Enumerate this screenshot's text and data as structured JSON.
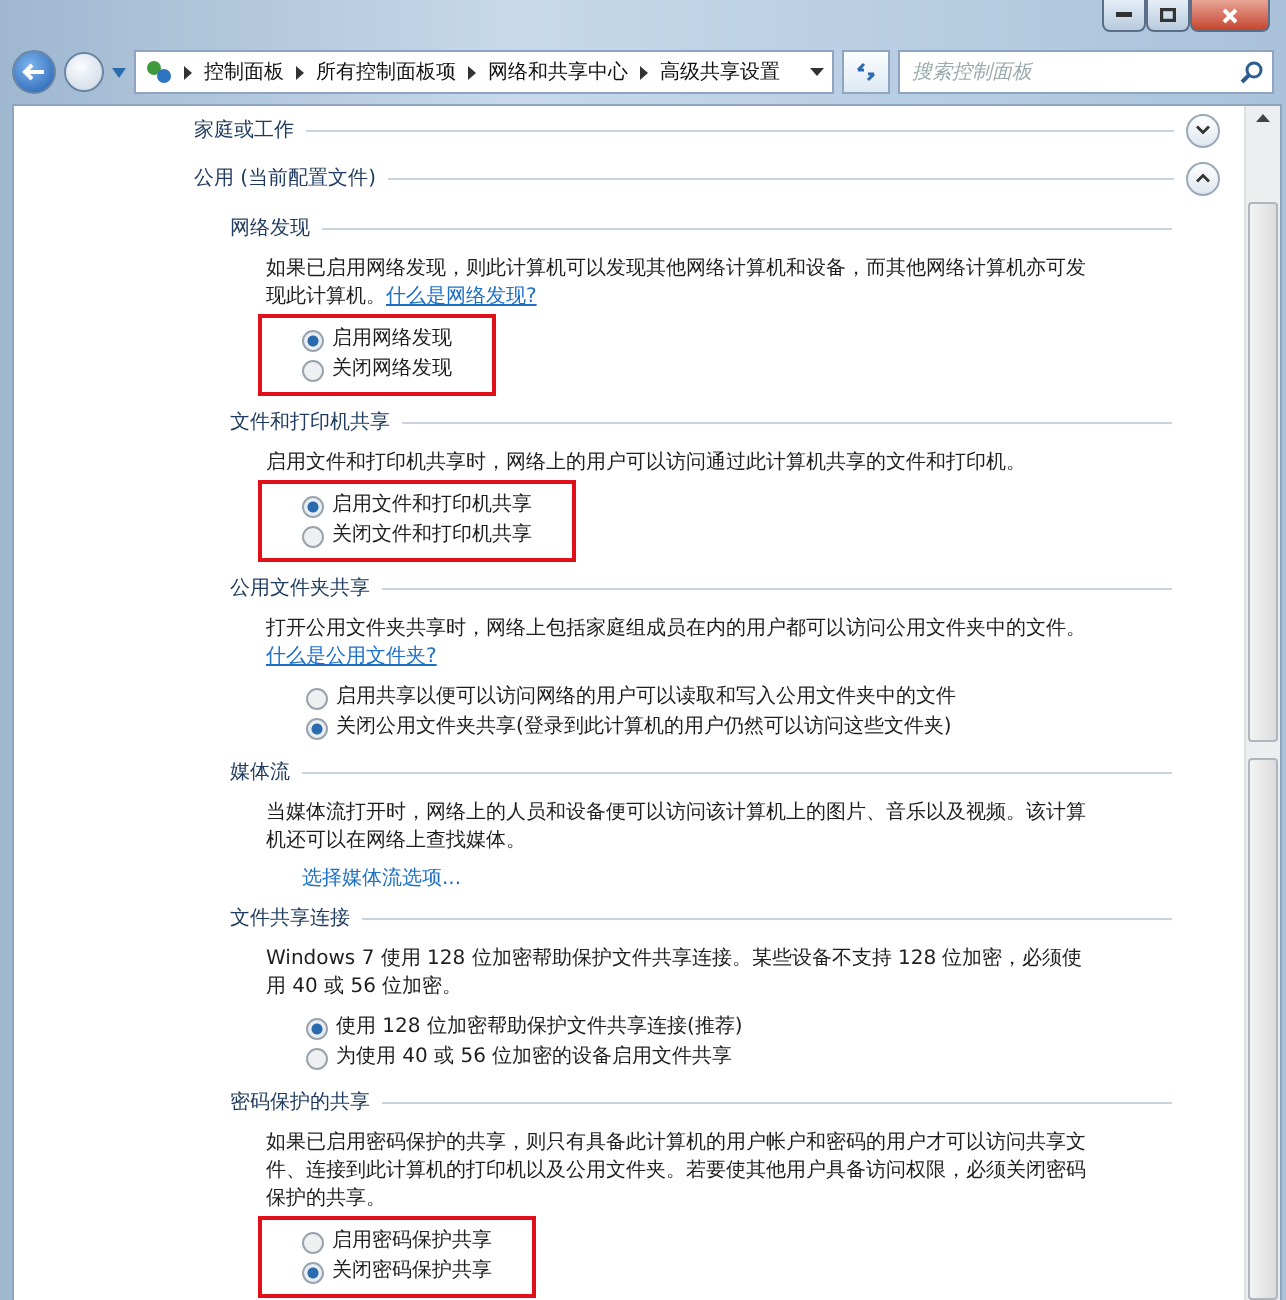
{
  "address_bar": {
    "breadcrumbs": [
      "控制面板",
      "所有控制面板项",
      "网络和共享中心",
      "高级共享设置"
    ]
  },
  "search": {
    "placeholder": "搜索控制面板"
  },
  "profiles": [
    {
      "name": "家庭或工作",
      "expanded": false
    },
    {
      "name": "公用 (当前配置文件)",
      "expanded": true,
      "sections": [
        {
          "title": "网络发现",
          "description": "如果已启用网络发现，则此计算机可以发现其他网络计算机和设备，而其他网络计算机亦可发现此计算机。",
          "link": "什么是网络发现?",
          "highlighted": true,
          "options": [
            {
              "label": "启用网络发现",
              "selected": true
            },
            {
              "label": "关闭网络发现",
              "selected": false
            }
          ]
        },
        {
          "title": "文件和打印机共享",
          "description": "启用文件和打印机共享时，网络上的用户可以访问通过此计算机共享的文件和打印机。",
          "highlighted": true,
          "options": [
            {
              "label": "启用文件和打印机共享",
              "selected": true
            },
            {
              "label": "关闭文件和打印机共享",
              "selected": false
            }
          ]
        },
        {
          "title": "公用文件夹共享",
          "description": "打开公用文件夹共享时，网络上包括家庭组成员在内的用户都可以访问公用文件夹中的文件。",
          "link": "什么是公用文件夹?",
          "highlighted": false,
          "options": [
            {
              "label": "启用共享以便可以访问网络的用户可以读取和写入公用文件夹中的文件",
              "selected": false
            },
            {
              "label": "关闭公用文件夹共享(登录到此计算机的用户仍然可以访问这些文件夹)",
              "selected": true
            }
          ]
        },
        {
          "title": "媒体流",
          "description": "当媒体流打开时，网络上的人员和设备便可以访问该计算机上的图片、音乐以及视频。该计算机还可以在网络上查找媒体。",
          "action_link": "选择媒体流选项..."
        },
        {
          "title": "文件共享连接",
          "description": "Windows 7 使用 128 位加密帮助保护文件共享连接。某些设备不支持 128 位加密，必须使用 40 或 56 位加密。",
          "highlighted": false,
          "options": [
            {
              "label": "使用 128 位加密帮助保护文件共享连接(推荐)",
              "selected": true
            },
            {
              "label": "为使用 40 或 56 位加密的设备启用文件共享",
              "selected": false
            }
          ]
        },
        {
          "title": "密码保护的共享",
          "description": "如果已启用密码保护的共享，则只有具备此计算机的用户帐户和密码的用户才可以访问共享文件、连接到此计算机的打印机以及公用文件夹。若要使其他用户具备访问权限，必须关闭密码保护的共享。",
          "highlighted": true,
          "options": [
            {
              "label": "启用密码保护共享",
              "selected": false
            },
            {
              "label": "关闭密码保护共享",
              "selected": true
            }
          ]
        }
      ]
    }
  ]
}
